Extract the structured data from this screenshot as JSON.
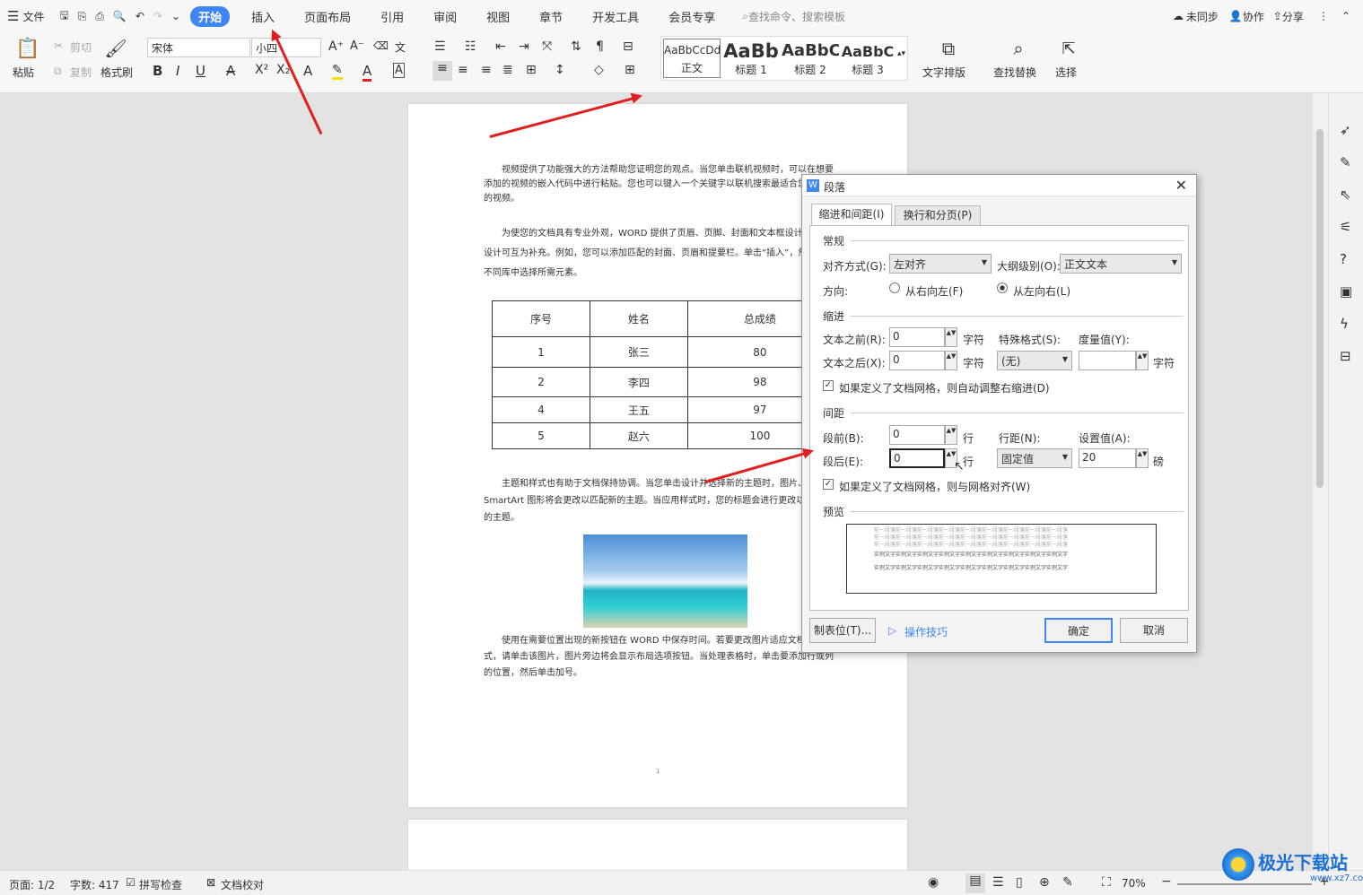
{
  "menubar": {
    "file": "文件",
    "tabs": [
      "开始",
      "插入",
      "页面布局",
      "引用",
      "审阅",
      "视图",
      "章节",
      "开发工具",
      "会员专享"
    ],
    "search": "查找命令、搜索模板",
    "sync": "未同步",
    "collab": "协作",
    "share": "分享"
  },
  "ribbon": {
    "paste": "粘贴",
    "cut": "剪切",
    "copy": "复制",
    "format_painter": "格式刷",
    "font": "宋体",
    "size": "小四",
    "styles": [
      {
        "preview": "AaBbCcDd",
        "name": "正文"
      },
      {
        "preview": "AaBb",
        "name": "标题 1"
      },
      {
        "preview": "AaBbC",
        "name": "标题 2"
      },
      {
        "preview": "AaBbC",
        "name": "标题 3"
      }
    ],
    "text_layout": "文字排版",
    "find_replace": "查找替换",
    "select": "选择"
  },
  "doc": {
    "p1": "视频提供了功能强大的方法帮助您证明您的观点。当您单击联机视频时，可以在想要添加的视频的嵌入代码中进行粘贴。您也可以键入一个关键字以联机搜索最适合您的文档的视频。",
    "p2": "为使您的文档具有专业外观，WORD 提供了页眉、页脚、封面和文本框设计，这些设计可互为补充。例如，您可以添加匹配的封面、页眉和提要栏。单击“插入”，然后从不同库中选择所需元素。",
    "table_header": [
      "序号",
      "姓名",
      "总成绩"
    ],
    "table_rows": [
      [
        "1",
        "张三",
        "80"
      ],
      [
        "2",
        "李四",
        "98"
      ],
      [
        "4",
        "王五",
        "97"
      ],
      [
        "5",
        "赵六",
        "100"
      ]
    ],
    "p3": "主题和样式也有助于文档保持协调。当您单击设计并选择新的主题时，图片、图表或 SmartArt 图形将会更改以匹配新的主题。当应用样式时，您的标题会进行更改以匹配新的主题。",
    "p4": "使用在需要位置出现的新按钮在 WORD 中保存时间。若要更改图片适应文档的方式，请单击该图片，图片旁边将会显示布局选项按钮。当处理表格时，单击要添加行或列的位置，然后单击加号。",
    "page_num": "1"
  },
  "dialog": {
    "title": "段落",
    "tabs": [
      "缩进和间距(I)",
      "换行和分页(P)"
    ],
    "sec_general": "常规",
    "align_label": "对齐方式(G):",
    "align_value": "左对齐",
    "outline_label": "大纲级别(O):",
    "outline_value": "正文文本",
    "dir_label": "方向:",
    "rtl": "从右向左(F)",
    "ltr": "从左向右(L)",
    "sec_indent": "缩进",
    "before_text": "文本之前(R):",
    "before_text_val": "0",
    "unit_char": "字符",
    "special": "特殊格式(S):",
    "measure": "度量值(Y):",
    "after_text": "文本之后(X):",
    "after_text_val": "0",
    "special_val": "(无)",
    "auto_indent": "如果定义了文档网格，则自动调整右缩进(D)",
    "sec_spacing": "间距",
    "space_before": "段前(B):",
    "space_before_val": "0",
    "unit_line": "行",
    "line_spacing": "行距(N):",
    "set_value": "设置值(A):",
    "space_after": "段后(E):",
    "space_after_val": "0",
    "line_spacing_val": "固定值",
    "set_value_val": "20",
    "unit_pt": "磅",
    "grid_align": "如果定义了文档网格，则与网格对齐(W)",
    "sec_preview": "预览",
    "preview_prev": "前一段落前一段落前一段落前一段落前一段落前一段落前一段落前一段落前一段落",
    "preview_sample": "实例文字实例文字实例文字实例文字实例文字实例文字实例文字实例文字实例文字",
    "tabs_btn": "制表位(T)...",
    "tips": "操作技巧",
    "ok": "确定",
    "cancel": "取消"
  },
  "status": {
    "page": "页面: 1/2",
    "words": "字数: 417",
    "spell": "拼写检查",
    "proof": "文档校对",
    "zoom": "70%"
  },
  "watermark": "极光下载站",
  "watermark_url": "www.xz7.com"
}
